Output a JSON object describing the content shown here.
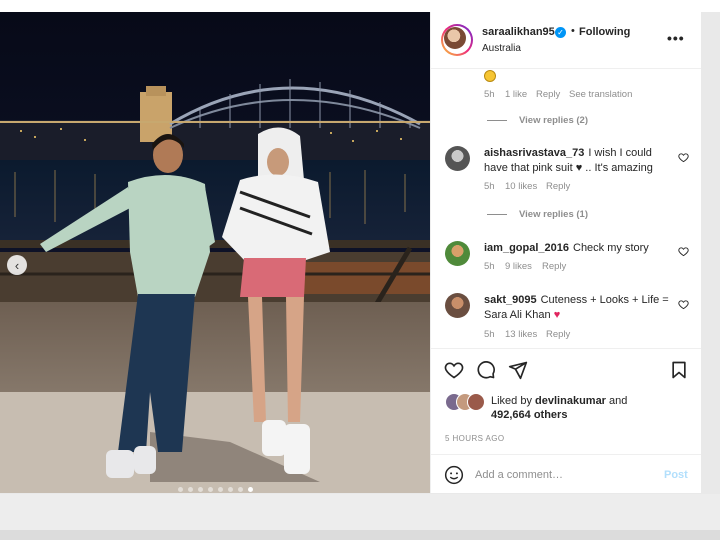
{
  "post": {
    "username": "saraalikhan95",
    "following_label": "Following",
    "separator": "•",
    "location": "Australia",
    "more_label": "•••",
    "verified_mark": "✓"
  },
  "photo": {
    "carousel": {
      "total": 8,
      "active_index": 7
    },
    "prev_label": "‹"
  },
  "comments": [
    {
      "id": "first",
      "emoji": "smiling-face-emoji",
      "meta": {
        "time": "5h",
        "likes": "1 like",
        "reply": "Reply",
        "translation": "See translation"
      },
      "view_replies": "View replies (2)"
    },
    {
      "id": "aishas",
      "username": "aishasrivastava_73",
      "text": "I wish I could have that pink suit ♥ .. It's amazing",
      "meta": {
        "time": "5h",
        "likes": "10 likes",
        "reply": "Reply"
      },
      "view_replies": "View replies (1)"
    },
    {
      "id": "gopal",
      "username": "iam_gopal_2016",
      "text": "Check my story",
      "meta": {
        "time": "5h",
        "likes": "9 likes",
        "reply": "Reply"
      }
    },
    {
      "id": "sakt",
      "username": "sakt_9095",
      "text": "Cuteness + Looks + Life = Sara Ali Khan",
      "meta": {
        "time": "5h",
        "likes": "13 likes",
        "reply": "Reply"
      }
    }
  ],
  "actions": {
    "liked_by_prefix": "Liked by",
    "liked_by_user": "devlinakumar",
    "liked_by_and": "and",
    "likes_count": "492,664 others",
    "time_ago": "5 HOURS AGO",
    "icons": [
      "heart-icon",
      "comment-icon",
      "share-icon",
      "bookmark-icon"
    ]
  },
  "add_comment": {
    "placeholder": "Add a comment…",
    "post_label": "Post"
  },
  "colors": {
    "verified": "#0095f6",
    "post_button_disabled": "#b2dffc",
    "meta_text": "#8e8e8e"
  }
}
